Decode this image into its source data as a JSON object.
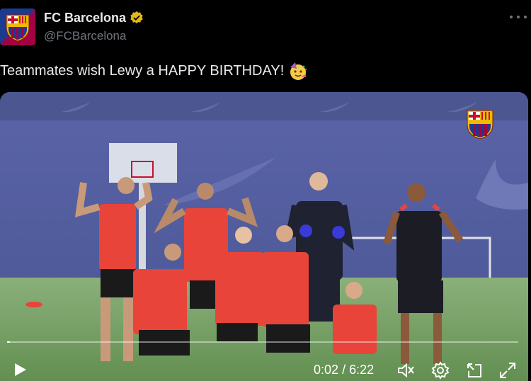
{
  "account": {
    "display_name": "FC Barcelona",
    "handle": "@FCBarcelona",
    "verified": true
  },
  "tweet": {
    "text": "Teammates wish Lewy a HAPPY BIRTHDAY!",
    "emoji": "partying-face"
  },
  "video": {
    "current_time": "0:02",
    "separator": "/",
    "duration": "6:22",
    "progress_fraction": 0.005
  },
  "colors": {
    "background": "#000000",
    "text_primary": "#e7e9ea",
    "text_secondary": "#71767b",
    "verified_gold": "#e2b719",
    "barca_blue": "#1a3b8f",
    "barca_red": "#a50044",
    "training_bib": "#e8443a"
  },
  "icons": [
    "more-icon",
    "verified-badge-icon",
    "play-icon",
    "volume-icon",
    "settings-icon",
    "popout-icon",
    "fullscreen-icon"
  ]
}
